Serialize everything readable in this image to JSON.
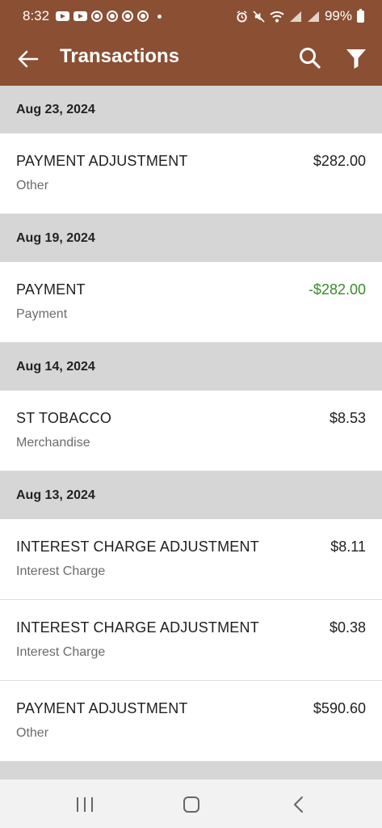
{
  "status_bar": {
    "time": "8:32",
    "battery": "99%",
    "icons": [
      "youtube-icon",
      "youtube-icon",
      "chrome-icon",
      "chrome-icon",
      "chrome-icon",
      "chrome-icon",
      "dot-icon",
      "alarm-icon",
      "mute-icon",
      "wifi-icon",
      "signal-icon",
      "signal-icon",
      "battery-icon"
    ]
  },
  "header": {
    "title": "Transactions",
    "icons": [
      "back-arrow-icon",
      "search-icon",
      "filter-icon"
    ]
  },
  "colors": {
    "header_bg": "#8b4f33",
    "date_header_bg": "#d6d6d6",
    "credit_amount": "#3a8a2a"
  },
  "groups": [
    {
      "date": "Aug 23, 2024",
      "transactions": [
        {
          "name": "PAYMENT ADJUSTMENT",
          "category": "Other",
          "amount": "$282.00"
        }
      ]
    },
    {
      "date": "Aug 19, 2024",
      "transactions": [
        {
          "name": "PAYMENT",
          "category": "Payment",
          "amount": "-$282.00"
        }
      ]
    },
    {
      "date": "Aug 14, 2024",
      "transactions": [
        {
          "name": "ST TOBACCO",
          "category": "Merchandise",
          "amount": "$8.53"
        }
      ]
    },
    {
      "date": "Aug 13, 2024",
      "transactions": [
        {
          "name": "INTEREST CHARGE ADJUSTMENT",
          "category": "Interest Charge",
          "amount": "$8.11"
        },
        {
          "name": "INTEREST CHARGE ADJUSTMENT",
          "category": "Interest Charge",
          "amount": "$0.38"
        },
        {
          "name": "PAYMENT ADJUSTMENT",
          "category": "Other",
          "amount": "$590.60"
        }
      ]
    }
  ],
  "nav_bar": {
    "icons": [
      "recents-icon",
      "home-icon",
      "back-icon"
    ]
  }
}
